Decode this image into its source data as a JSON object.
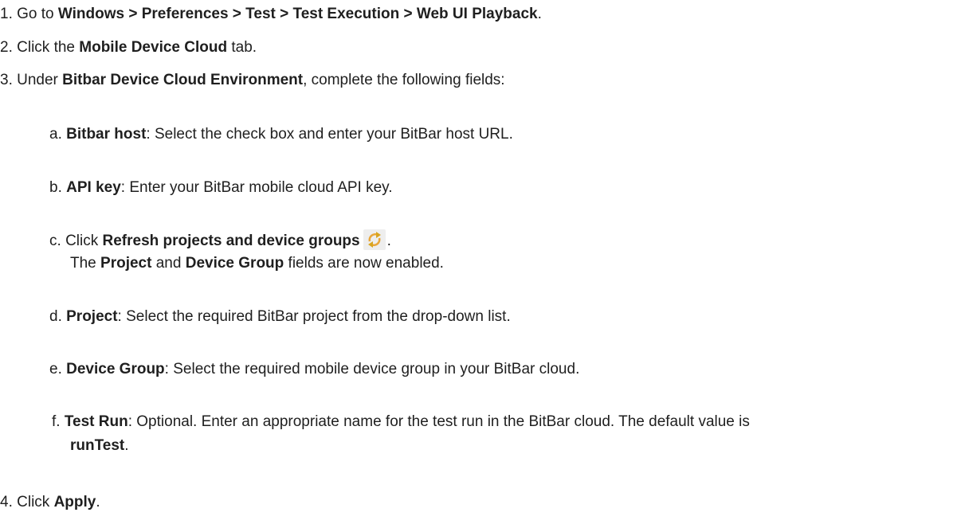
{
  "steps": [
    {
      "num": "1. ",
      "text_prefix": "Go to ",
      "bold": "Windows > Preferences > Test > Test Execution > Web UI Playback",
      "text_suffix": "."
    },
    {
      "num": "2. ",
      "text_prefix": "Click the ",
      "bold": "Mobile Device Cloud",
      "text_suffix": " tab."
    },
    {
      "num": "3. ",
      "text_prefix": "Under ",
      "bold": "Bitbar Device Cloud Environment",
      "text_suffix": ", complete the following fields:"
    },
    {
      "num": "4. ",
      "text_prefix": "Click ",
      "bold": "Apply",
      "text_suffix": "."
    }
  ],
  "substeps": {
    "a": {
      "letter": "a. ",
      "bold": "Bitbar host",
      "text": ": Select the check box and enter your BitBar host URL."
    },
    "b": {
      "letter": "b. ",
      "bold": "API key",
      "text": ": Enter your BitBar mobile cloud API key."
    },
    "c": {
      "letter": "c. ",
      "text_prefix": "Click ",
      "bold": "Refresh projects and device groups",
      "icon": "refresh-icon",
      "text_suffix": ".",
      "line2_prefix": "The ",
      "line2_bold1": "Project",
      "line2_mid": " and ",
      "line2_bold2": "Device Group",
      "line2_suffix": " fields are now enabled."
    },
    "d": {
      "letter": "d. ",
      "bold": "Project",
      "text": ": Select the required BitBar project from the drop-down list."
    },
    "e": {
      "letter": "e. ",
      "bold": "Device Group",
      "text": ": Select the required mobile device group in your BitBar cloud."
    },
    "f": {
      "letter": "f. ",
      "bold": "Test Run",
      "text": ": Optional. Enter an appropriate name for the test run in the BitBar cloud. The default value is",
      "line2_bold": "runTest",
      "line2_suffix": "."
    }
  },
  "colors": {
    "text": "#1f1f1f",
    "icon_orange": "#e8a63a",
    "icon_gold": "#d9a520"
  }
}
